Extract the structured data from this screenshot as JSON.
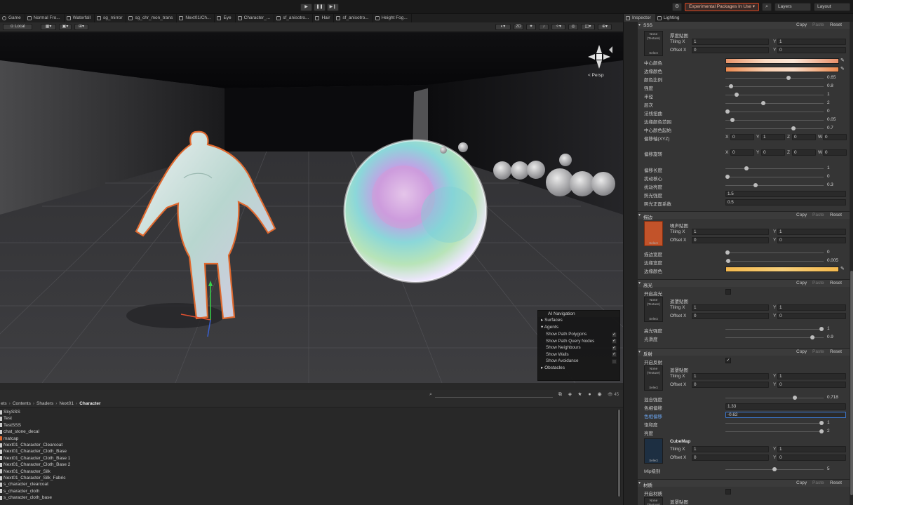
{
  "toolbar": {
    "play_icon": "▶",
    "pause_icon": "❚❚",
    "step_icon": "▶❙",
    "experimental_label": "Experimental Packages In Use ▾",
    "search_icon": "⌕",
    "layers_label": "Layers",
    "layout_label": "Layout",
    "accent_color": "#e0451e"
  },
  "scene_tabs": [
    "Game",
    "Normal Fro...",
    "Waterfall",
    "sg_mirror",
    "sg_chr_mon_trans",
    "Next01/Ch...",
    "Eye",
    "Character_...",
    "sf_anisotro...",
    "Hair",
    "sf_anisotro...",
    "Height Fog..."
  ],
  "scene_tools": {
    "local_label": "Local",
    "view_2d_label": "2D",
    "persp_label": "< Persp"
  },
  "ai_navigation": {
    "title": "AI Navigation",
    "surfaces_label": "Surfaces",
    "agents_label": "Agents",
    "options": [
      {
        "label": "Show Path Polygons",
        "checked": true
      },
      {
        "label": "Show Path Query Nodes",
        "checked": true
      },
      {
        "label": "Show Neighbours",
        "checked": true
      },
      {
        "label": "Show Walls",
        "checked": true
      },
      {
        "label": "Show Avoidance",
        "checked": false
      }
    ],
    "obstacles_label": "Obstacles"
  },
  "project": {
    "count": "45",
    "breadcrumb": [
      "ets",
      "Contents",
      "Shaders",
      "Next01",
      "Character"
    ],
    "files": [
      {
        "name": "SkySSS",
        "warn": false
      },
      {
        "name": "Test",
        "warn": false
      },
      {
        "name": "TestSSS",
        "warn": false
      },
      {
        "name": "chat_stone_decal",
        "warn": false
      },
      {
        "name": "matcap",
        "warn": true
      },
      {
        "name": "Next01_Character_Clearcoat",
        "warn": false
      },
      {
        "name": "Next01_Character_Cloth_Base",
        "warn": false
      },
      {
        "name": "Next01_Character_Cloth_Base 1",
        "warn": false
      },
      {
        "name": "Next01_Character_Cloth_Base 2",
        "warn": false
      },
      {
        "name": "Next01_Character_Silk",
        "warn": false
      },
      {
        "name": "Next01_Character_Silk_Fabric",
        "warn": false
      },
      {
        "name": "s_character_clearcoat",
        "warn": false
      },
      {
        "name": "s_character_cloth",
        "warn": false
      },
      {
        "name": "s_character_cloth_base",
        "warn": false
      }
    ]
  },
  "inspector": {
    "tabs": [
      "Inspector",
      "Lighting"
    ],
    "copy_label": "Copy",
    "paste_label": "Paste",
    "reset_label": "Reset",
    "tex_none": "None\n(Texture)",
    "tex_select": "Select",
    "tiling_label": "Tiling X",
    "offset_label": "Offset X",
    "y_label": "Y",
    "one": "1",
    "zero": "0",
    "sss": {
      "title": "SSS",
      "tex_label": "厚度贴图",
      "center_color": "中心颜色",
      "edge_color": "边缘颜色",
      "color_ratio": "颜色比例",
      "color_ratio_val": "0.65",
      "intensity": "强度",
      "intensity_val": "0.8",
      "radius": "半径",
      "radius_val": "1",
      "layers": "层次",
      "layers_val": "2",
      "dist_distort": "法线扭曲",
      "dist_distort_val": "0",
      "edge_range": "边缘颜色范围",
      "edge_range_val": "0.05",
      "center_start": "中心颜色起始",
      "center_start_val": "0.7",
      "offset_xyz": "偏移轴(XYZ)",
      "vec_x": "X",
      "vec_y": "Y",
      "vec_z": "Z",
      "vec_w": "W",
      "vec_vals": [
        "0",
        "1",
        "0",
        "0"
      ],
      "offset_rot": "偏移旋转",
      "rot_vals": [
        "0",
        "0",
        "0",
        "0"
      ],
      "offset_len": "偏移长度",
      "offset_len_val": "1",
      "perturb_center": "扰动核心",
      "perturb_center_val": "0",
      "perturb_bright": "扰动亮度",
      "perturb_bright_val": "0.3",
      "gi_strength": "照光强度",
      "gi_strength_val": "1.5",
      "gi_enhance": "照光正面系数",
      "gi_enhance_val": "0.5"
    },
    "edge": {
      "title": "描边",
      "tex_label": "噪声贴图",
      "edge_width": "描边宽度",
      "edge_width_val": "0",
      "edge_thick": "边缘宽度",
      "edge_thick_val": "0.005",
      "edge_color": "边缘颜色"
    },
    "gloss": {
      "title": "高光",
      "enable": "开启高光",
      "tex_label": "遮罩贴图",
      "gloss_int": "高光强度",
      "gloss_int_val": "1",
      "smooth": "光滑度",
      "smooth_val": "0.9"
    },
    "reflect": {
      "title": "反射",
      "enable": "开启反射",
      "tex_label": "遮罩贴图",
      "mix": "混合强度",
      "mix_val": "0.718",
      "hue": "色相偏移",
      "hue_val": "1.33",
      "sat": "色相偏移",
      "sat_val": "-0.62",
      "contrast": "饱和度",
      "contrast_val": "1",
      "bright": "亮度",
      "bright_val": "2",
      "cube_label": "CubeMap",
      "mip": "Mip级别",
      "mip_val": "5"
    },
    "matcap": {
      "title": "材质",
      "enable": "开启材质",
      "tex_label": "遮罩贴图"
    }
  }
}
